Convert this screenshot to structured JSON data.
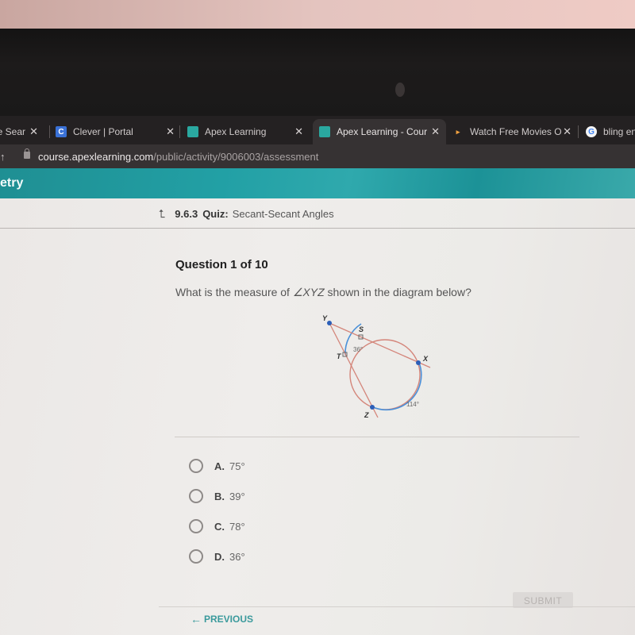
{
  "browser": {
    "tabs": [
      {
        "label": "le Sear",
        "favicon": "tab-icon",
        "active": false
      },
      {
        "label": "Clever | Portal",
        "favicon": "clever-icon",
        "favicon_glyph": "C",
        "active": false
      },
      {
        "label": "Apex Learning",
        "favicon": "apex-icon",
        "active": false
      },
      {
        "label": "Apex Learning - Cour",
        "favicon": "apex-icon",
        "active": true
      },
      {
        "label": "Watch Free Movies O",
        "favicon": "play-icon",
        "favicon_glyph": "▸",
        "active": false
      },
      {
        "label": "bling en",
        "favicon": "google-icon",
        "favicon_glyph": "G",
        "active": false
      }
    ],
    "close_glyph": "✕",
    "address": {
      "host": "course.apexlearning.com",
      "path": "/public/activity/9006003/assessment"
    }
  },
  "app": {
    "course_title_fragment": "etry",
    "breadcrumb": {
      "number": "9.6.3",
      "kind": "Quiz:",
      "title": "Secant-Secant Angles"
    }
  },
  "question": {
    "header": "Question 1 of 10",
    "prompt_before": "What is the measure of ",
    "angle_symbol": "∠",
    "angle_name": "XYZ",
    "prompt_after": " shown in the diagram below?",
    "diagram": {
      "points": {
        "Y": "Y",
        "S": "S",
        "T": "T",
        "X": "X",
        "Z": "Z"
      },
      "arc_small": "36°",
      "arc_large": "114°",
      "colors": {
        "secant": "#d4857a",
        "arc_highlight": "#4a90d9",
        "arc_other": "#d4857a",
        "point": "#2c5fb8"
      }
    },
    "choices": [
      {
        "letter": "A.",
        "value": "75°"
      },
      {
        "letter": "B.",
        "value": "39°"
      },
      {
        "letter": "C.",
        "value": "78°"
      },
      {
        "letter": "D.",
        "value": "36°"
      }
    ]
  },
  "footer": {
    "submit_label": "SUBMIT",
    "previous_label": "PREVIOUS",
    "previous_glyph": "←"
  },
  "colors": {
    "accent": "#22a0a5",
    "link": "#3a9a9c"
  }
}
